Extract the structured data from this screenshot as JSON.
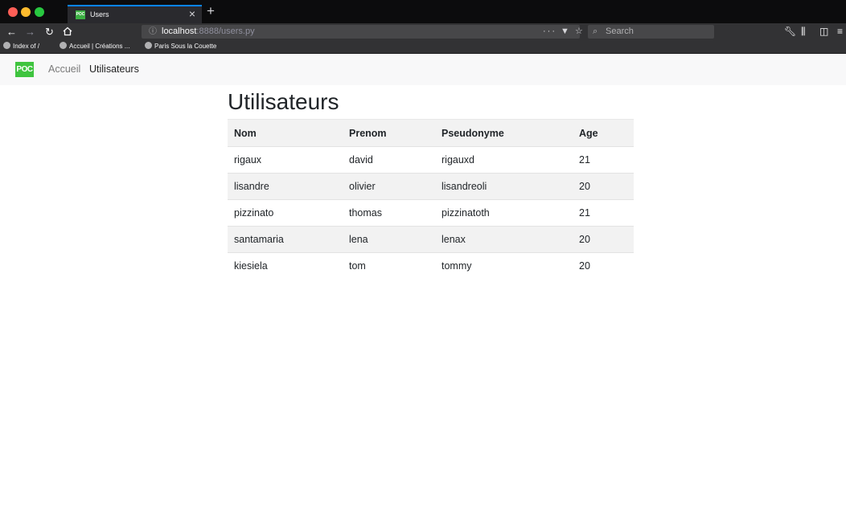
{
  "browser": {
    "tab_title": "Users",
    "url_host": "localhost",
    "url_rest": ":8888/users.py",
    "search_placeholder": "Search",
    "bookmarks": [
      "Index of /",
      "Accueil | Créations ...",
      "Paris Sous la Couette"
    ]
  },
  "nav": {
    "brand": "POC",
    "links": [
      "Accueil",
      "Utilisateurs"
    ]
  },
  "page": {
    "title": "Utilisateurs"
  },
  "table": {
    "headers": [
      "Nom",
      "Prenom",
      "Pseudonyme",
      "Age"
    ],
    "rows": [
      [
        "rigaux",
        "david",
        "rigauxd",
        "21"
      ],
      [
        "lisandre",
        "olivier",
        "lisandreoli",
        "20"
      ],
      [
        "pizzinato",
        "thomas",
        "pizzinatoth",
        "21"
      ],
      [
        "santamaria",
        "lena",
        "lenax",
        "20"
      ],
      [
        "kiesiela",
        "tom",
        "tommy",
        "20"
      ]
    ]
  },
  "colors": {
    "brand": "#3fc43f",
    "tab_accent": "#0a84ff",
    "row_stripe": "#f2f2f2"
  }
}
